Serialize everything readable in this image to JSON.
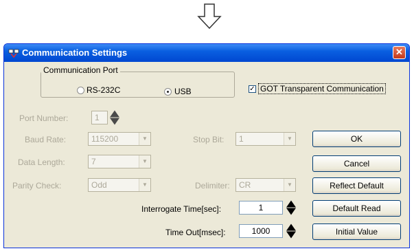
{
  "dialog": {
    "title": "Communication Settings",
    "close_label": "✕"
  },
  "communication_port": {
    "legend": "Communication Port",
    "options": [
      {
        "label": "RS-232C",
        "selected": false
      },
      {
        "label": "USB",
        "selected": true
      }
    ]
  },
  "got_transparent": {
    "label": "GOT Transparent Communication",
    "checked": true
  },
  "port_number": {
    "label": "Port Number:",
    "value": "1"
  },
  "baud_rate": {
    "label": "Baud Rate:",
    "value": "115200"
  },
  "stop_bit": {
    "label": "Stop Bit:",
    "value": "1"
  },
  "data_length": {
    "label": "Data Length:",
    "value": "7"
  },
  "parity_check": {
    "label": "Parity Check:",
    "value": "Odd"
  },
  "delimiter": {
    "label": "Delimiter:",
    "value": "CR"
  },
  "interrogate_time": {
    "label": "Interrogate Time[sec]:",
    "value": "1"
  },
  "time_out": {
    "label": "Time Out[msec]:",
    "value": "1000"
  },
  "buttons": {
    "ok": "OK",
    "cancel": "Cancel",
    "reflect_default": "Reflect Default",
    "default_read": "Default Read",
    "initial_value": "Initial Value"
  }
}
